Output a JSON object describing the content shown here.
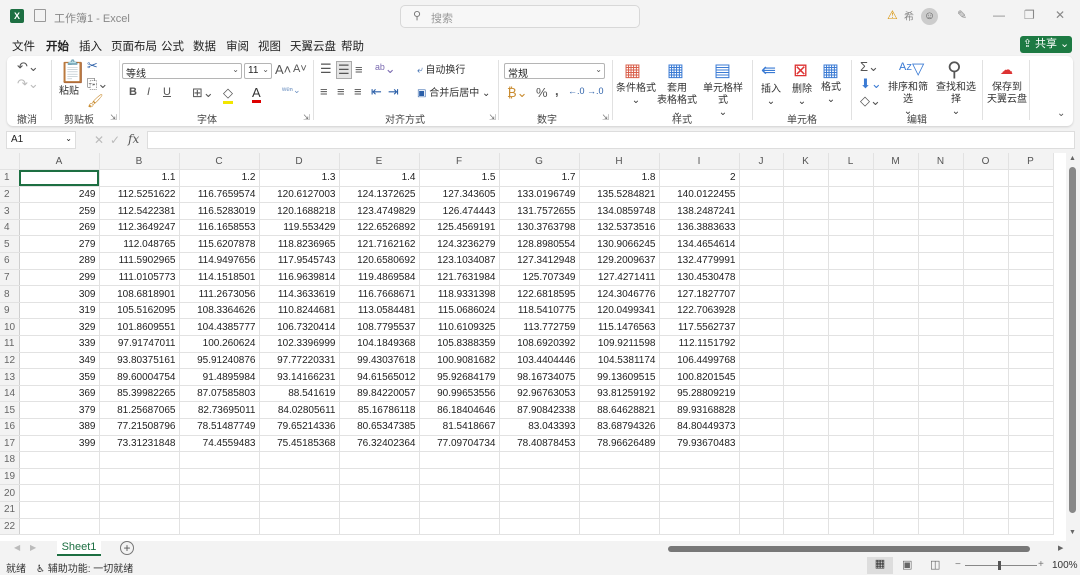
{
  "titlebar": {
    "app_title": "工作簿1 - Excel",
    "search_placeholder": "搜索",
    "user_initial": "希"
  },
  "menu": {
    "items": [
      "文件",
      "开始",
      "插入",
      "页面布局",
      "公式",
      "数据",
      "审阅",
      "视图",
      "天翼云盘",
      "帮助"
    ],
    "active": "开始",
    "share": "共享"
  },
  "ribbon": {
    "groups": {
      "undo": "撤消",
      "clipboard": "剪贴板",
      "font": "字体",
      "alignment": "对齐方式",
      "number": "数字",
      "styles": "样式",
      "cells": "单元格",
      "editing": "编辑"
    },
    "paste": "粘贴",
    "font_name": "等线",
    "font_size": "11",
    "wrap_text": "自动换行",
    "merge_center": "合并后居中",
    "number_format": "常规",
    "conditional_format": "条件格式",
    "table_format_1": "套用",
    "table_format_2": "表格格式",
    "cell_styles": "单元格样式",
    "insert": "插入",
    "delete": "删除",
    "format": "格式",
    "sort_filter": "排序和筛选",
    "find_select": "查找和选择",
    "save_cloud_1": "保存到",
    "save_cloud_2": "天翼云盘",
    "bold": "B",
    "italic": "I",
    "underline": "U",
    "percent": "%",
    "comma": ","
  },
  "formula_bar": {
    "name_box": "A1",
    "fx": "fx",
    "value": ""
  },
  "columns": [
    "A",
    "B",
    "C",
    "D",
    "E",
    "F",
    "G",
    "H",
    "I",
    "J",
    "K",
    "L",
    "M",
    "N",
    "O",
    "P"
  ],
  "rows": [
    [
      "",
      "1.1",
      "1.2",
      "1.3",
      "1.4",
      "1.5",
      "1.7",
      "1.8",
      "2"
    ],
    [
      "249",
      "112.5251622",
      "116.7659574",
      "120.6127003",
      "124.1372625",
      "127.343605",
      "133.0196749",
      "135.5284821",
      "140.0122455"
    ],
    [
      "259",
      "112.5422381",
      "116.5283019",
      "120.1688218",
      "123.4749829",
      "126.474443",
      "131.7572655",
      "134.0859748",
      "138.2487241"
    ],
    [
      "269",
      "112.3649247",
      "116.1658553",
      "119.553429",
      "122.6526892",
      "125.4569191",
      "130.3763798",
      "132.5373516",
      "136.3883633"
    ],
    [
      "279",
      "112.048765",
      "115.6207878",
      "118.8236965",
      "121.7162162",
      "124.3236279",
      "128.8980554",
      "130.9066245",
      "134.4654614"
    ],
    [
      "289",
      "111.5902965",
      "114.9497656",
      "117.9545743",
      "120.6580692",
      "123.1034087",
      "127.3412948",
      "129.2009637",
      "132.4779991"
    ],
    [
      "299",
      "111.0105773",
      "114.1518501",
      "116.9639814",
      "119.4869584",
      "121.7631984",
      "125.707349",
      "127.4271411",
      "130.4530478"
    ],
    [
      "309",
      "108.6818901",
      "111.2673056",
      "114.3633619",
      "116.7668671",
      "118.9331398",
      "122.6818595",
      "124.3046776",
      "127.1827707"
    ],
    [
      "319",
      "105.5162095",
      "108.3364626",
      "110.8244681",
      "113.0584481",
      "115.0686024",
      "118.5410775",
      "120.0499341",
      "122.7063928"
    ],
    [
      "329",
      "101.8609551",
      "104.4385777",
      "106.7320414",
      "108.7795537",
      "110.6109325",
      "113.772759",
      "115.1476563",
      "117.5562737"
    ],
    [
      "339",
      "97.91747011",
      "100.260624",
      "102.3396999",
      "104.1849368",
      "105.8388359",
      "108.6920392",
      "109.9211598",
      "112.1151792"
    ],
    [
      "349",
      "93.80375161",
      "95.91240876",
      "97.77220331",
      "99.43037618",
      "100.9081682",
      "103.4404446",
      "104.5381174",
      "106.4499768"
    ],
    [
      "359",
      "89.60004754",
      "91.4895984",
      "93.14166231",
      "94.61565012",
      "95.92684179",
      "98.16734075",
      "99.13609515",
      "100.8201545"
    ],
    [
      "369",
      "85.39982265",
      "87.07585803",
      "88.541619",
      "89.84220057",
      "90.99653556",
      "92.96763053",
      "93.81259192",
      "95.28809219"
    ],
    [
      "379",
      "81.25687065",
      "82.73695011",
      "84.02805611",
      "85.16786118",
      "86.18404646",
      "87.90842338",
      "88.64628821",
      "89.93168828"
    ],
    [
      "389",
      "77.21508796",
      "78.51487749",
      "79.65214336",
      "80.65347385",
      "81.5418667",
      "83.043393",
      "83.68794326",
      "84.80449373"
    ],
    [
      "399",
      "73.31231848",
      "74.4559483",
      "75.45185368",
      "76.32402364",
      "77.09704734",
      "78.40878453",
      "78.96626489",
      "79.93670483"
    ]
  ],
  "total_rows_visible": 22,
  "sheets": {
    "tabs": [
      "Sheet1"
    ],
    "add": "+"
  },
  "status": {
    "ready": "就绪",
    "accessibility": "辅助功能: 一切就绪",
    "zoom": "100%"
  }
}
